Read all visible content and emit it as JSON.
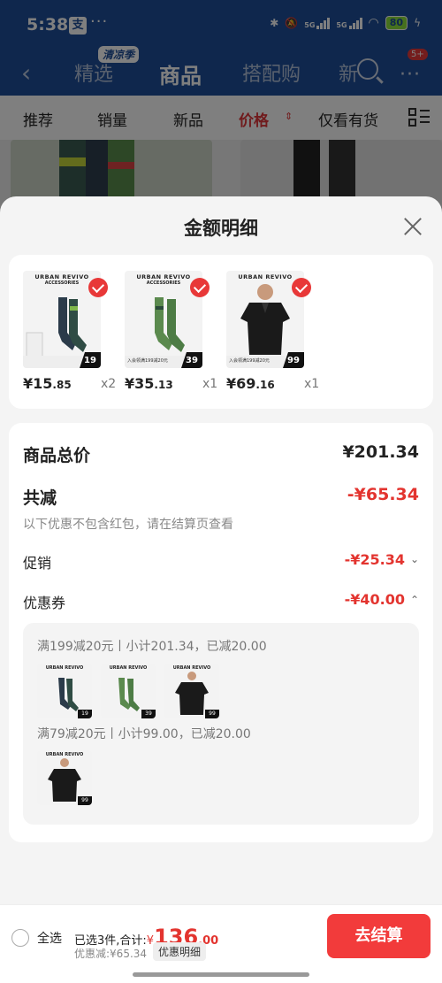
{
  "status": {
    "time": "5:38",
    "app_icon": "支",
    "dots": "···",
    "battery": "80",
    "net1": "5G",
    "net2": "5G"
  },
  "nav": {
    "tabs": [
      "精选",
      "商品",
      "搭配购",
      "新"
    ],
    "season_badge": "清凉季",
    "cart_badge": "5+"
  },
  "filters": [
    "推荐",
    "销量",
    "新品",
    "价格",
    "仅看有货"
  ],
  "sheet": {
    "title": "金额明细"
  },
  "products": [
    {
      "brand": "URBAN REVIVO",
      "sub": "ACCESSORIES",
      "tag": "19",
      "price_int": "¥15",
      "price_dec": ".85",
      "qty": "x2",
      "promo": ""
    },
    {
      "brand": "URBAN REVIVO",
      "sub": "ACCESSORIES",
      "tag": "39",
      "price_int": "¥35",
      "price_dec": ".13",
      "qty": "x1",
      "promo": "入会领满199减20元"
    },
    {
      "brand": "URBAN REVIVO",
      "sub": "",
      "tag": "99",
      "price_int": "¥69",
      "price_dec": ".16",
      "qty": "x1",
      "promo": "入会领满199减20元"
    }
  ],
  "breakdown": {
    "total_label": "商品总价",
    "total_value": "¥201.34",
    "reduce_label": "共减",
    "reduce_value": "-¥65.34",
    "note": "以下优惠不包含红包，请在结算页查看",
    "promo_label": "促销",
    "promo_value": "-¥25.34",
    "coupon_label": "优惠券",
    "coupon_value": "-¥40.00",
    "coupon_rules": [
      {
        "text": "满199减20元丨小计201.34，已减20.00",
        "items": [
          "19",
          "39",
          "99"
        ]
      },
      {
        "text": "满79减20元丨小计99.00，已减20.00",
        "items": [
          "99"
        ]
      }
    ]
  },
  "bottom": {
    "select_all": "全选",
    "selected": "已选3件,合计:",
    "currency": "¥",
    "total_int": "136",
    "total_dec": ".00",
    "discount": "优惠减:¥65.34",
    "detail": "优惠明细",
    "checkout": "去结算"
  }
}
